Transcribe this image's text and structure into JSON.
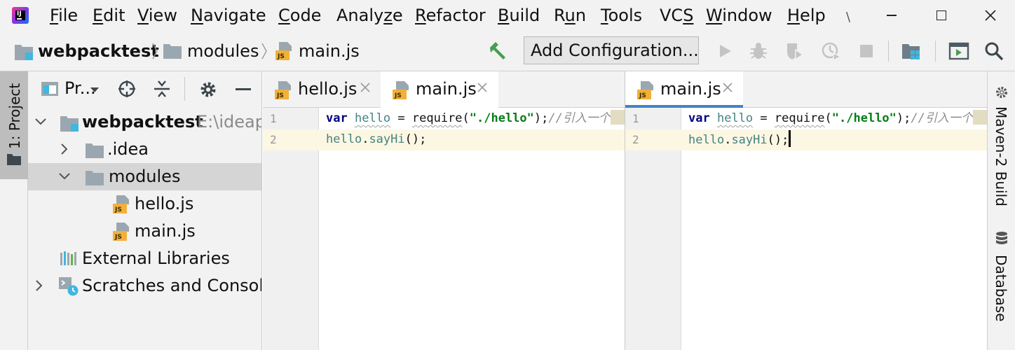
{
  "menubar": {
    "items": [
      {
        "pre": "",
        "mn": "F",
        "post": "ile"
      },
      {
        "pre": "",
        "mn": "E",
        "post": "dit"
      },
      {
        "pre": "",
        "mn": "V",
        "post": "iew"
      },
      {
        "pre": "",
        "mn": "N",
        "post": "avigate"
      },
      {
        "pre": "",
        "mn": "C",
        "post": "ode"
      },
      {
        "pre": "Analy",
        "mn": "z",
        "post": "e"
      },
      {
        "pre": "",
        "mn": "R",
        "post": "efactor"
      },
      {
        "pre": "",
        "mn": "B",
        "post": "uild"
      },
      {
        "pre": "R",
        "mn": "u",
        "post": "n"
      },
      {
        "pre": "",
        "mn": "T",
        "post": "ools"
      },
      {
        "pre": "VC",
        "mn": "S",
        "post": ""
      },
      {
        "pre": "",
        "mn": "W",
        "post": "indow"
      },
      {
        "pre": "",
        "mn": "H",
        "post": "elp"
      }
    ],
    "overflow": "\\"
  },
  "breadcrumb": {
    "project": "webpacktest",
    "folder": "modules",
    "file": "main.js"
  },
  "toolbar": {
    "add_configuration": "Add Configuration..."
  },
  "left_stripe": {
    "project_tab": "1: Project"
  },
  "project_panel": {
    "title": "Pr...",
    "tree": [
      {
        "label": "webpacktest",
        "hint": "E:\\ideap",
        "expanded": true
      },
      {
        "label": ".idea"
      },
      {
        "label": "modules",
        "expanded": true
      },
      {
        "label": "hello.js"
      },
      {
        "label": "main.js"
      },
      {
        "label": "External Libraries"
      },
      {
        "label": "Scratches and Consoles"
      }
    ]
  },
  "editor_left": {
    "tabs": [
      "hello.js",
      "main.js"
    ],
    "line_numbers": [
      "1",
      "2"
    ]
  },
  "editor_right": {
    "tabs": [
      "main.js"
    ],
    "line_numbers": [
      "1",
      "2"
    ]
  },
  "code": {
    "l1_kw": "var",
    "l1_var": "hello",
    "l1_eq": " = ",
    "l1_fn": "require",
    "l1_open": "(",
    "l1_str": "\"./hello\"",
    "l1_close": ");",
    "l1_cmt": "//引入一个",
    "l2_obj": "hello",
    "l2_dot": ".",
    "l2_mth": "sayHi",
    "l2_end": "();"
  },
  "right_stripe": {
    "maven": "Maven-2 Build",
    "database": "Database"
  },
  "colors": {
    "accent": "#4083c9",
    "chrome": "#f2f2f2",
    "caret_line": "#fcf7e3",
    "keyword": "#000080",
    "string": "#067d17",
    "comment": "#8c8c8c",
    "js_icon": "#f0b03a"
  }
}
